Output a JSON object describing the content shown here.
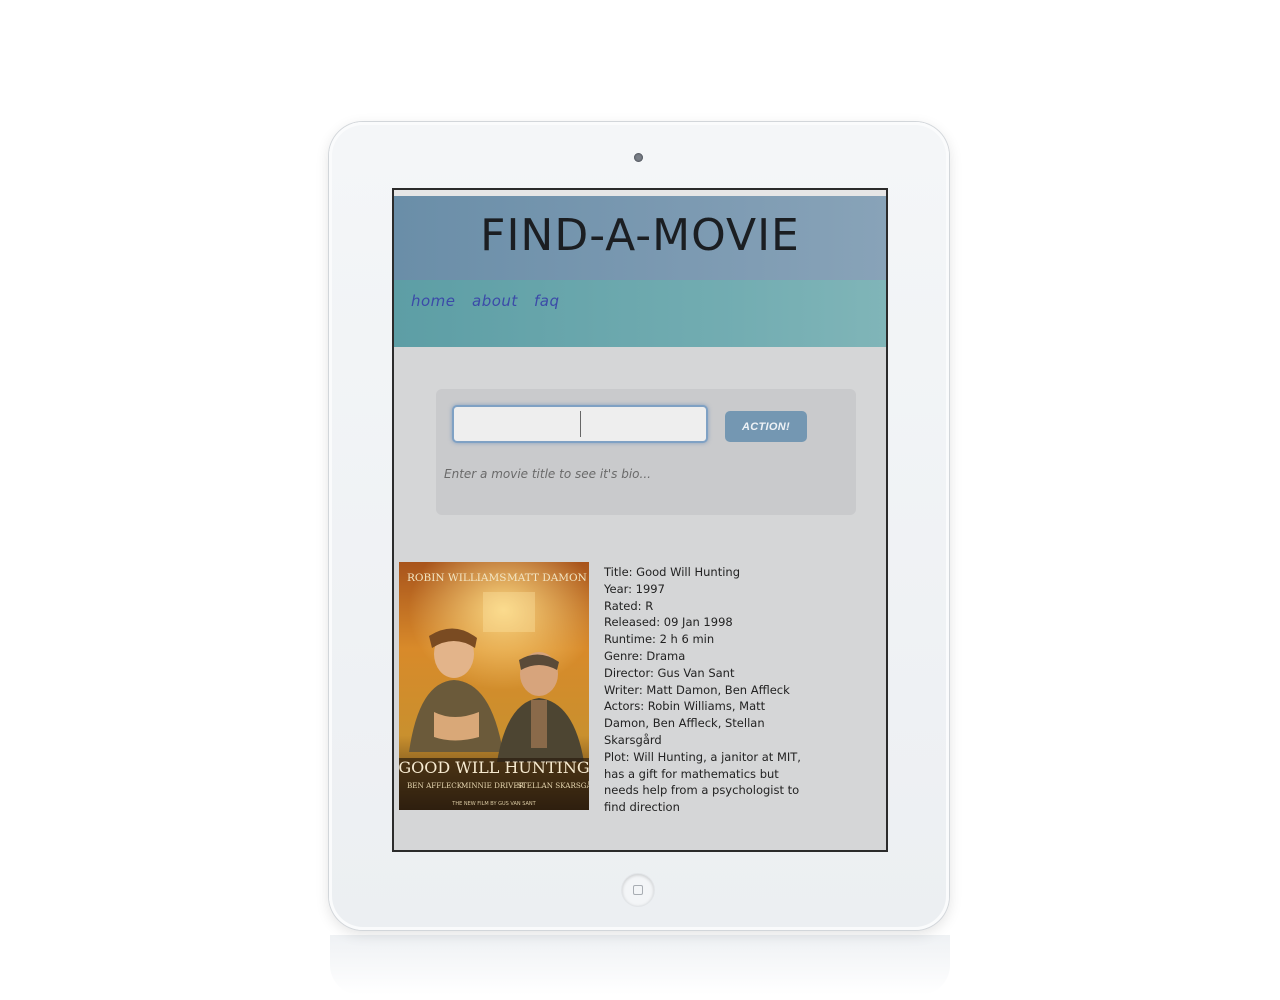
{
  "site": {
    "title": "FIND-A-MOVIE"
  },
  "nav": {
    "items": [
      {
        "label": "home"
      },
      {
        "label": "about"
      },
      {
        "label": "faq"
      }
    ]
  },
  "search": {
    "value": "",
    "placeholder": "",
    "button_label": "ACTION!",
    "hint": "Enter a movie title to see it's bio..."
  },
  "movie": {
    "poster": {
      "top_credits": [
        "ROBIN WILLIAMS",
        "MATT DAMON"
      ],
      "title": "GOOD WILL HUNTING",
      "bottom_credits": [
        "BEN AFFLECK",
        "MINNIE DRIVER",
        "STELLAN SKARSGÅRD"
      ],
      "tagline": "THE NEW FILM BY GUS VAN SANT"
    },
    "lines": [
      "Title: Good Will Hunting",
      "Year: 1997",
      "Rated: R",
      "Released: 09 Jan 1998",
      "Runtime: 2 h 6 min",
      "Genre: Drama",
      "Director: Gus Van Sant",
      "Writer: Matt Damon, Ben Affleck",
      "Actors: Robin Williams, Matt Damon, Ben Affleck, Stellan Skarsgård",
      "Plot: Will Hunting, a janitor at MIT, has a gift for mathematics but needs help from a psychologist to find direction"
    ]
  }
}
